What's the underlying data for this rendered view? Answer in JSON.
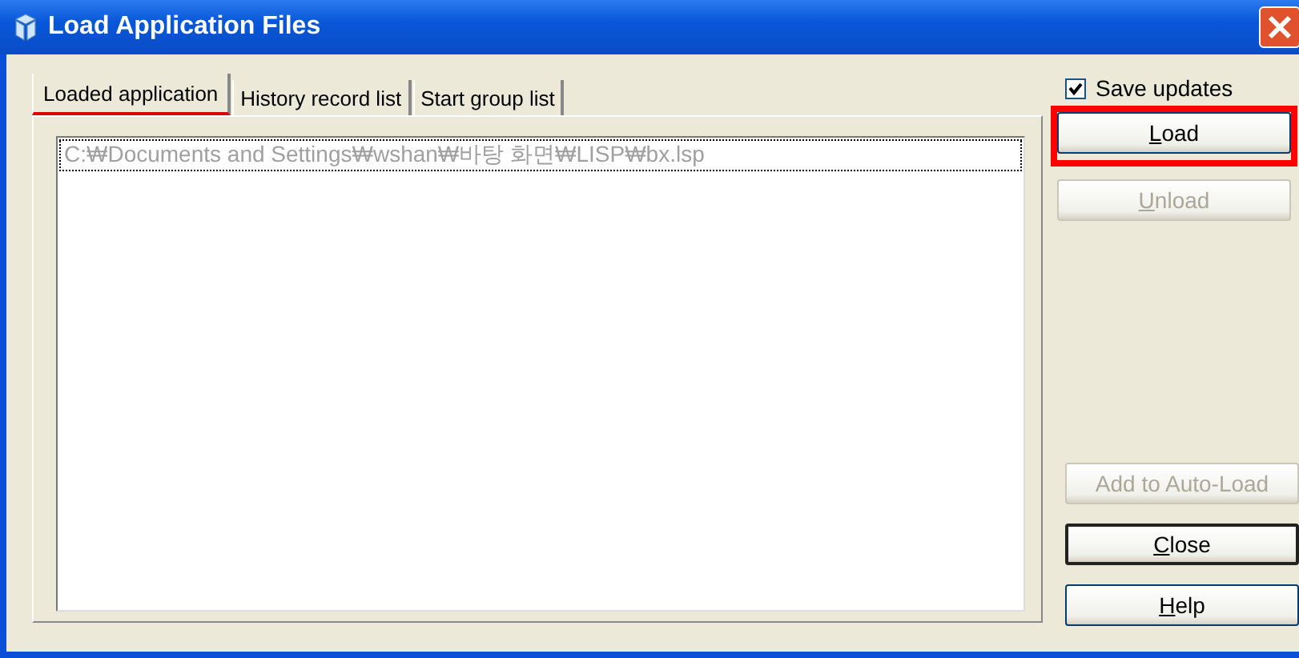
{
  "window": {
    "title": "Load Application Files"
  },
  "tabs": [
    {
      "label": "Loaded application",
      "selected": true,
      "annotated": true
    },
    {
      "label": "History record list",
      "selected": false,
      "annotated": false
    },
    {
      "label": "Start group list",
      "selected": false,
      "annotated": false
    }
  ],
  "file_list": {
    "items": [
      {
        "text": "C:₩Documents and Settings₩wshan₩바탕 화면₩LISP₩bx.lsp",
        "disabled": true,
        "focused": true
      }
    ]
  },
  "save_updates": {
    "label": "Save updates",
    "checked": true
  },
  "top_buttons": [
    {
      "label": "Load",
      "disabled": false,
      "underline_first": true,
      "annotated": true,
      "default": false
    },
    {
      "label": "Unload",
      "disabled": true,
      "underline_first": true,
      "annotated": false,
      "default": false
    }
  ],
  "bottom_buttons": [
    {
      "label": "Add to Auto-Load",
      "disabled": true,
      "underline_first": false,
      "annotated": false,
      "default": false
    },
    {
      "label": "Close",
      "disabled": false,
      "underline_first": true,
      "annotated": false,
      "default": true
    },
    {
      "label": "Help",
      "disabled": false,
      "underline_first": true,
      "annotated": false,
      "default": false
    }
  ]
}
